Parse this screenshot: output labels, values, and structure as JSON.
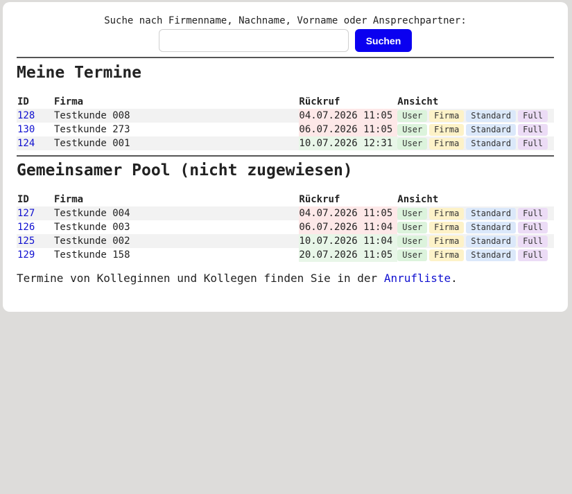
{
  "search": {
    "label": "Suche nach Firmenname, Nachname, Vorname oder Ansprechpartner:",
    "value": "",
    "button": "Suchen"
  },
  "sections": [
    {
      "title": "Meine Termine",
      "headers": [
        "ID",
        "Firma",
        "Rückruf",
        "Ansicht"
      ],
      "rows": [
        {
          "id": "128",
          "firma": "Testkunde 008",
          "rueckruf": "04.07.2026 11:05",
          "status": "red"
        },
        {
          "id": "130",
          "firma": "Testkunde 273",
          "rueckruf": "06.07.2026 11:05",
          "status": "red"
        },
        {
          "id": "124",
          "firma": "Testkunde 001",
          "rueckruf": "10.07.2026 12:31",
          "status": "green"
        }
      ]
    },
    {
      "title": "Gemeinsamer Pool (nicht zugewiesen)",
      "headers": [
        "ID",
        "Firma",
        "Rückruf",
        "Ansicht"
      ],
      "rows": [
        {
          "id": "127",
          "firma": "Testkunde 004",
          "rueckruf": "04.07.2026 11:05",
          "status": "red"
        },
        {
          "id": "126",
          "firma": "Testkunde 003",
          "rueckruf": "06.07.2026 11:04",
          "status": "red"
        },
        {
          "id": "125",
          "firma": "Testkunde 002",
          "rueckruf": "10.07.2026 11:04",
          "status": "green"
        },
        {
          "id": "129",
          "firma": "Testkunde 158",
          "rueckruf": "20.07.2026 11:05",
          "status": "green"
        }
      ]
    }
  ],
  "view_tags": [
    "User",
    "Firma",
    "Standard",
    "Full"
  ],
  "footer": {
    "text": "Termine von Kolleginnen und Kollegen finden Sie in der ",
    "link": "Anrufliste",
    "suffix": "."
  },
  "colors": {
    "button": "#0a00f0",
    "link": "#1010d0",
    "overdue": "#fde8e8",
    "upcoming": "#e8f6e8"
  }
}
